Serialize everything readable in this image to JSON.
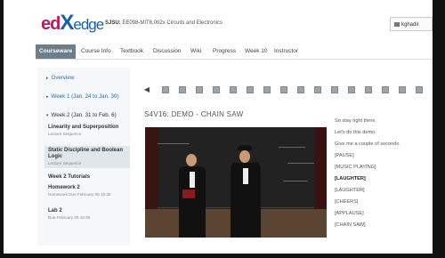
{
  "header": {
    "logo_ed": "ed",
    "logo_x": "X",
    "logo_edge": "edge",
    "course_code": "SJSU:",
    "course_name": "EE098-MIT6.002x Circuits and Electronics",
    "username": "kghadir"
  },
  "tabs": [
    {
      "label": "Courseware",
      "active": true
    },
    {
      "label": "Course Info",
      "active": false
    },
    {
      "label": "Textbook",
      "active": false
    },
    {
      "label": "Discussion",
      "active": false
    },
    {
      "label": "Wiki",
      "active": false
    },
    {
      "label": "Progress",
      "active": false
    },
    {
      "label": "Week 10",
      "active": false
    },
    {
      "label": "Instructor",
      "active": false
    }
  ],
  "sidebar": {
    "overview": "Overview",
    "week1": "Week 1 (Jan. 24 to Jan. 30)",
    "week2": "Week 2 (Jan. 31 to Feb. 6)",
    "lessons": [
      {
        "title": "Linearity and Superposition",
        "sub": "Lecture Sequence"
      },
      {
        "title": "Static Discipline and Boolean Logic",
        "sub": "Lecture Sequence"
      }
    ],
    "tutorials": "Week 2 Tutorials",
    "homework_title": "Homework 2",
    "homework_sub": "Homework Due February 06 18:30",
    "lab_title": "Lab 2",
    "lab_sub": "Due February 06 18:30"
  },
  "main": {
    "unit_title": "S4V16: DEMO - CHAIN SAW"
  },
  "transcript": {
    "lines": [
      {
        "text": "So stay right there.",
        "bold": false
      },
      {
        "text": "Let's do this demo.",
        "bold": false
      },
      {
        "text": "Give me a couple of seconds.",
        "bold": false
      },
      {
        "text": "[PAUSE]",
        "bold": false
      },
      {
        "text": "[MUSIC PLAYING]",
        "bold": false
      },
      {
        "text": "[LAUGHTER]",
        "bold": true
      },
      {
        "text": "[LAUGHTER]",
        "bold": false
      },
      {
        "text": "[CHEERS]",
        "bold": false
      },
      {
        "text": "[APPLAUSE]",
        "bold": false
      },
      {
        "text": "[CHAIN SAW]",
        "bold": false
      }
    ]
  },
  "seq_nav": {
    "prev_arrow": "◀"
  }
}
